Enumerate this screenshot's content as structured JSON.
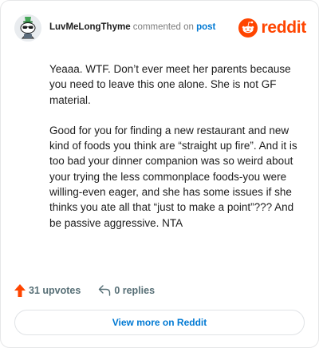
{
  "header": {
    "username": "LuvMeLongThyme",
    "action_text": "commented on",
    "post_link": "post",
    "brand": "reddit",
    "brand_color": "#ff4500",
    "avatar_icon": "snoo-avatar-icon"
  },
  "comment": {
    "paragraphs": [
      "Yeaaa. WTF. Don’t ever meet her parents because you need to leave this one alone. She is not GF material.",
      "Good for you for finding a new restaurant and new kind of foods you think are “straight up fire”. And it is too bad your dinner companion was so weird about your trying the less commonplace foods-you were willing-even eager, and she has some issues if she thinks you ate all that “just to make a point”??? And be passive aggressive. NTA"
    ]
  },
  "actions": {
    "upvotes": "31 upvotes",
    "replies": "0 replies",
    "upvote_icon": "upvote-arrow-icon",
    "reply_icon": "reply-arrow-icon",
    "upvote_color": "#ff4500"
  },
  "footer": {
    "view_more": "View more on Reddit",
    "link_color": "#0079d3"
  }
}
